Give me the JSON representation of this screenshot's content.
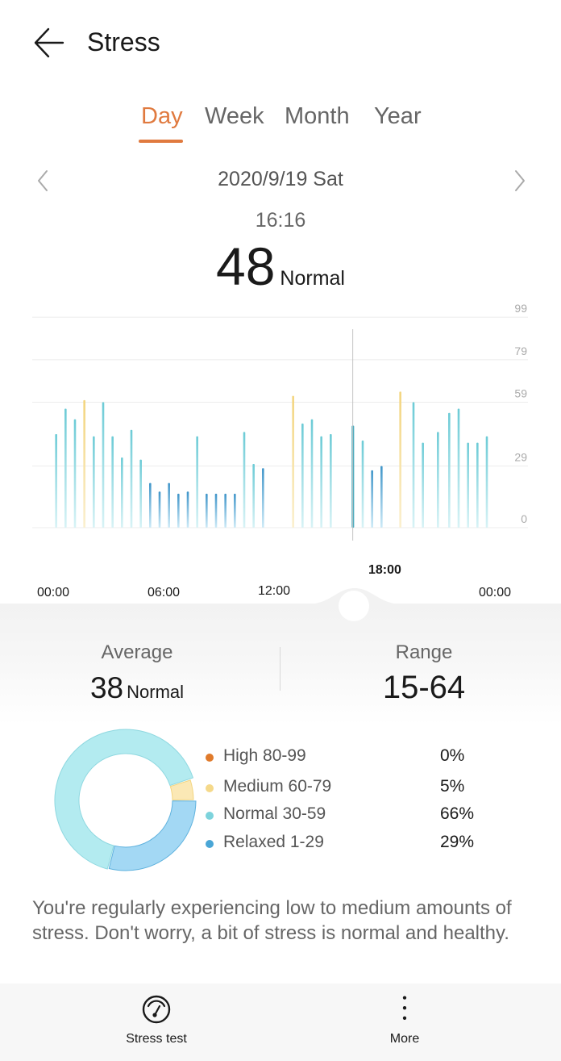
{
  "header": {
    "title": "Stress",
    "back_icon": "arrow-left-icon"
  },
  "tabs": [
    {
      "label": "Day",
      "active": true
    },
    {
      "label": "Week",
      "active": false
    },
    {
      "label": "Month",
      "active": false
    },
    {
      "label": "Year",
      "active": false
    }
  ],
  "date_nav": {
    "date": "2020/9/19  Sat",
    "prev_icon": "chevron-left-icon",
    "next_icon": "chevron-right-icon"
  },
  "selected_point": {
    "time": "16:16",
    "value": "48",
    "status": "Normal"
  },
  "chart_data": {
    "type": "bar",
    "title": "",
    "xlabel": "",
    "ylabel": "",
    "x_unit": "hour of day",
    "x_range": [
      0,
      24
    ],
    "ylim": [
      0,
      99
    ],
    "y_ticks": [
      0,
      29,
      59,
      79,
      99
    ],
    "y_tick_labels": [
      "0",
      "29",
      "59",
      "79",
      "99"
    ],
    "x_tick_labels": [
      "00:00",
      "06:00",
      "12:00",
      "18:00",
      "00:00"
    ],
    "x_tick_hours": [
      0,
      6,
      12,
      18,
      24
    ],
    "grid": true,
    "selected_hour": 16.27,
    "colors": {
      "normal": "#7dd3dc",
      "relaxed": "#4aa6d6",
      "medium": "#f5d98a",
      "high": "#e07a2b",
      "cursor": "#bbbbbb"
    },
    "points": [
      {
        "hour": 0.5,
        "value": 44
      },
      {
        "hour": 1.0,
        "value": 56
      },
      {
        "hour": 1.5,
        "value": 51
      },
      {
        "hour": 2.0,
        "value": 60
      },
      {
        "hour": 2.5,
        "value": 43
      },
      {
        "hour": 3.0,
        "value": 59
      },
      {
        "hour": 3.5,
        "value": 43
      },
      {
        "hour": 4.0,
        "value": 33
      },
      {
        "hour": 4.5,
        "value": 46
      },
      {
        "hour": 5.0,
        "value": 32
      },
      {
        "hour": 5.5,
        "value": 21
      },
      {
        "hour": 6.0,
        "value": 17
      },
      {
        "hour": 6.5,
        "value": 21
      },
      {
        "hour": 7.0,
        "value": 16
      },
      {
        "hour": 7.5,
        "value": 17
      },
      {
        "hour": 8.0,
        "value": 43
      },
      {
        "hour": 8.5,
        "value": 16
      },
      {
        "hour": 9.0,
        "value": 16
      },
      {
        "hour": 9.5,
        "value": 16
      },
      {
        "hour": 10.0,
        "value": 16
      },
      {
        "hour": 10.5,
        "value": 45
      },
      {
        "hour": 11.0,
        "value": 30
      },
      {
        "hour": 11.5,
        "value": 28
      },
      {
        "hour": 13.1,
        "value": 62
      },
      {
        "hour": 13.6,
        "value": 49
      },
      {
        "hour": 14.1,
        "value": 51
      },
      {
        "hour": 14.6,
        "value": 43
      },
      {
        "hour": 15.1,
        "value": 44
      },
      {
        "hour": 16.27,
        "value": 48
      },
      {
        "hour": 16.8,
        "value": 41
      },
      {
        "hour": 17.3,
        "value": 27
      },
      {
        "hour": 17.8,
        "value": 29
      },
      {
        "hour": 18.8,
        "value": 64
      },
      {
        "hour": 19.5,
        "value": 59
      },
      {
        "hour": 20.0,
        "value": 40
      },
      {
        "hour": 20.8,
        "value": 45
      },
      {
        "hour": 21.4,
        "value": 54
      },
      {
        "hour": 21.9,
        "value": 56
      },
      {
        "hour": 22.4,
        "value": 40
      },
      {
        "hour": 22.9,
        "value": 40
      },
      {
        "hour": 23.4,
        "value": 43
      }
    ]
  },
  "summary": {
    "average_label": "Average",
    "average_value": "38",
    "average_status": "Normal",
    "range_label": "Range",
    "range_value": "15-64"
  },
  "distribution": [
    {
      "label": "High 80-99",
      "percent_text": "0%",
      "percent": 0,
      "color": "#e07a2b",
      "fill": "#f0b07a"
    },
    {
      "label": "Medium 60-79",
      "percent_text": "5%",
      "percent": 5,
      "color": "#f5d98a",
      "fill": "#fbe8b5"
    },
    {
      "label": "Normal 30-59",
      "percent_text": "66%",
      "percent": 66,
      "color": "#7dd3dc",
      "fill": "#b3ebf0"
    },
    {
      "label": "Relaxed 1-29",
      "percent_text": "29%",
      "percent": 29,
      "color": "#4aa6d6",
      "fill": "#a3d8f4"
    }
  ],
  "description": "You're regularly experiencing low to medium amounts of stress. Don't worry, a bit of stress is normal and healthy.",
  "bottom_bar": {
    "stress_test_label": "Stress test",
    "stress_test_icon": "gauge-icon",
    "more_label": "More",
    "more_icon": "more-vertical-icon"
  }
}
